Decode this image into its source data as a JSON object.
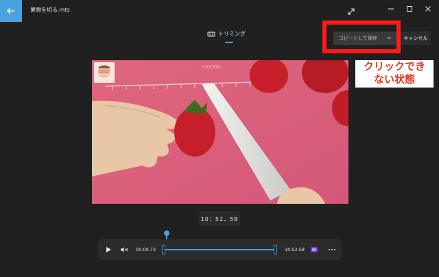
{
  "window": {
    "title": "果物を切る.mts"
  },
  "tabs": {
    "trim_label": "トリミング"
  },
  "actions": {
    "save_copy_label": "コピーとして保存",
    "cancel_label": "キャンセル"
  },
  "annotation": {
    "line1": "クリックでき",
    "line2": "ない状態"
  },
  "video": {
    "watermark": "KYOCERA"
  },
  "player": {
    "current_time": "10：52．58",
    "start_time": "00:00.73",
    "end_time": "10:52.58"
  },
  "icons": {
    "back": "back-arrow-icon",
    "expand": "expand-icon",
    "minimize": "minimize-icon",
    "maximize": "maximize-icon",
    "close": "close-icon",
    "trim": "trim-icon",
    "chevron": "chevron-down-icon",
    "play": "play-icon",
    "volume": "mute-icon",
    "clip": "clip-icon",
    "more": "more-icon"
  },
  "colors": {
    "accent": "#4aa3df",
    "highlight_border": "#ff1a1a",
    "note_text": "#e33a1c",
    "background": "#202020"
  }
}
